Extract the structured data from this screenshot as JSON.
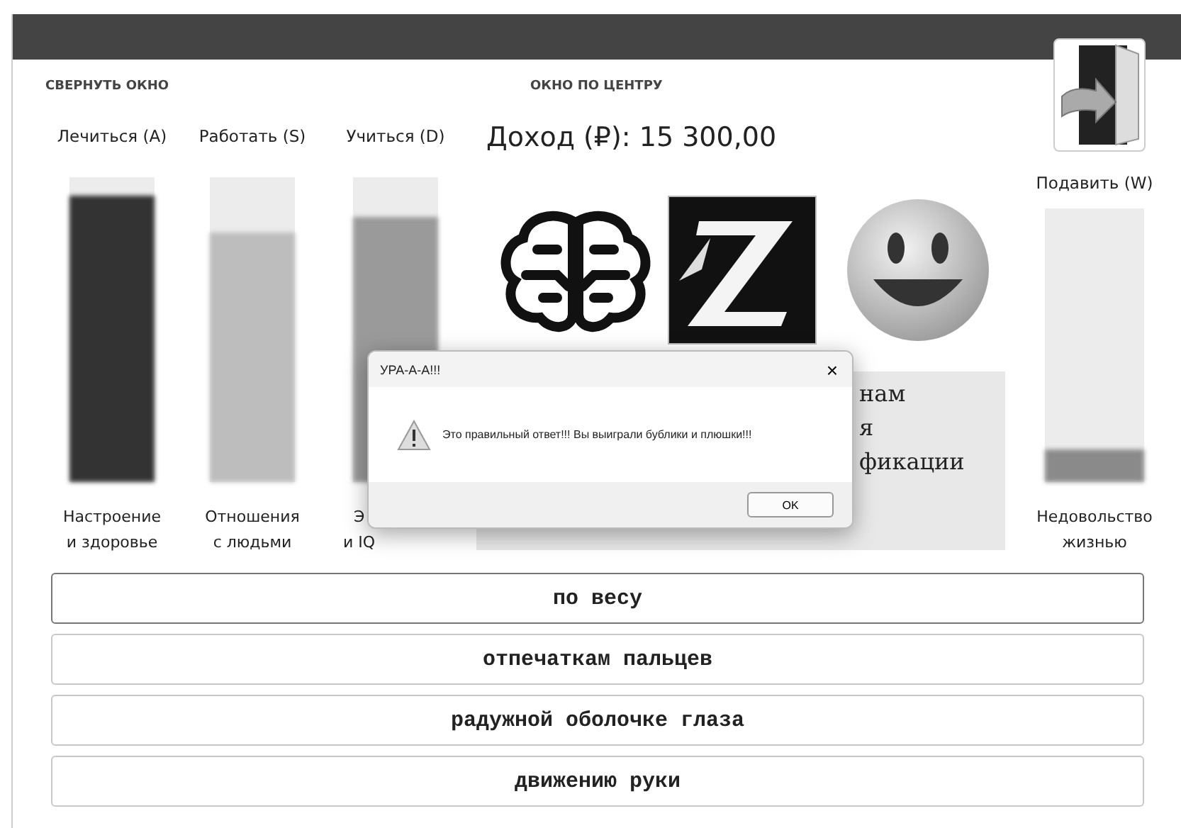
{
  "header": {
    "minimize_link": "СВЕРНУТЬ ОКНО",
    "center_link": "ОКНО ПО ЦЕНТРУ",
    "income": "Доход (₽): 15 300,00"
  },
  "stats": [
    {
      "action": "Лечиться (A)",
      "lines": [
        "Настроение",
        "и здоровье"
      ],
      "level": 0.94,
      "color": "#333333",
      "cut_by_dialog": false
    },
    {
      "action": "Работать (S)",
      "lines": [
        "Отношения",
        "с людьми"
      ],
      "level": 0.82,
      "color": "#bdbdbd",
      "cut_by_dialog": false
    },
    {
      "action": "Учиться (D)",
      "lines": [
        "Э",
        "и IQ"
      ],
      "level": 0.87,
      "color": "#9a9a9a",
      "cut_by_dialog": true
    }
  ],
  "dissatisfaction": {
    "action": "Подавить (W)",
    "lines": [
      "Недовольство",
      "жизнью"
    ],
    "level": 0.12,
    "color": "#8a8a8a"
  },
  "question_lines": [
    "нам",
    "я",
    "фикации"
  ],
  "answers": [
    {
      "label": "по весу",
      "selected": true
    },
    {
      "label": "отпечаткам пальцев",
      "selected": false
    },
    {
      "label": "радужной оболочке глаза",
      "selected": false
    },
    {
      "label": "движению руки",
      "selected": false
    }
  ],
  "dialog": {
    "title": "УРА-А-А!!!",
    "close": "×",
    "message": "Это правильный ответ!!! Вы выиграли бублики и плюшки!!!",
    "button": "OK"
  }
}
